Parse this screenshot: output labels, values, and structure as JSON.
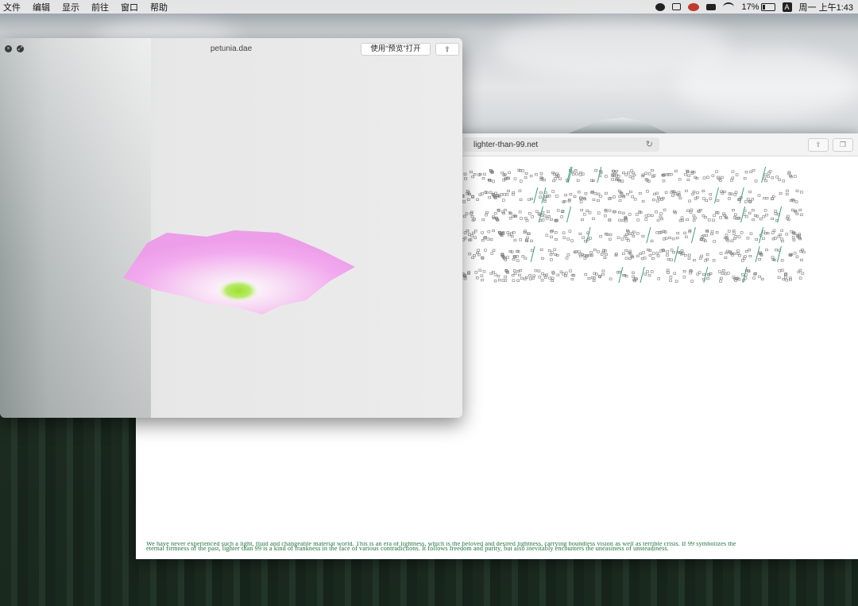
{
  "menubar": {
    "items": [
      "文件",
      "编辑",
      "显示",
      "前往",
      "窗口",
      "帮助"
    ],
    "battery_percent": "17%",
    "input_method": "A",
    "clock": "周一 上午1:43"
  },
  "quicklook": {
    "title": "petunia.dae",
    "open_with_label": "使用“预览”打开",
    "share_icon": "share-icon",
    "close_icon": "close-icon",
    "fullscreen_icon": "fullscreen-icon",
    "model_colors": {
      "petal": "#f2a9ee",
      "center": "#a6e43c"
    }
  },
  "browser": {
    "url": "lighter-than-99.net",
    "reload_icon": "reload-icon",
    "share_icon": "share-icon",
    "tabs_icon": "tabs-icon",
    "slash_color": "#3aa374",
    "prose_color": "#1f6f3a",
    "prose_lines": [
      "We have never experienced such a light, fluid and changeable material world. This is an era of lightness, which is the beloved and desired lightness, carrying boundless vision as well as terrible crisis. If 99 symbolizes the",
      "eternal firmness of the past, lighter than 99 is a kind of frankness in the face of various contradictions. It follows freedom and purity, but also inevitably encounters the uneasiness of unsteadiness."
    ]
  }
}
